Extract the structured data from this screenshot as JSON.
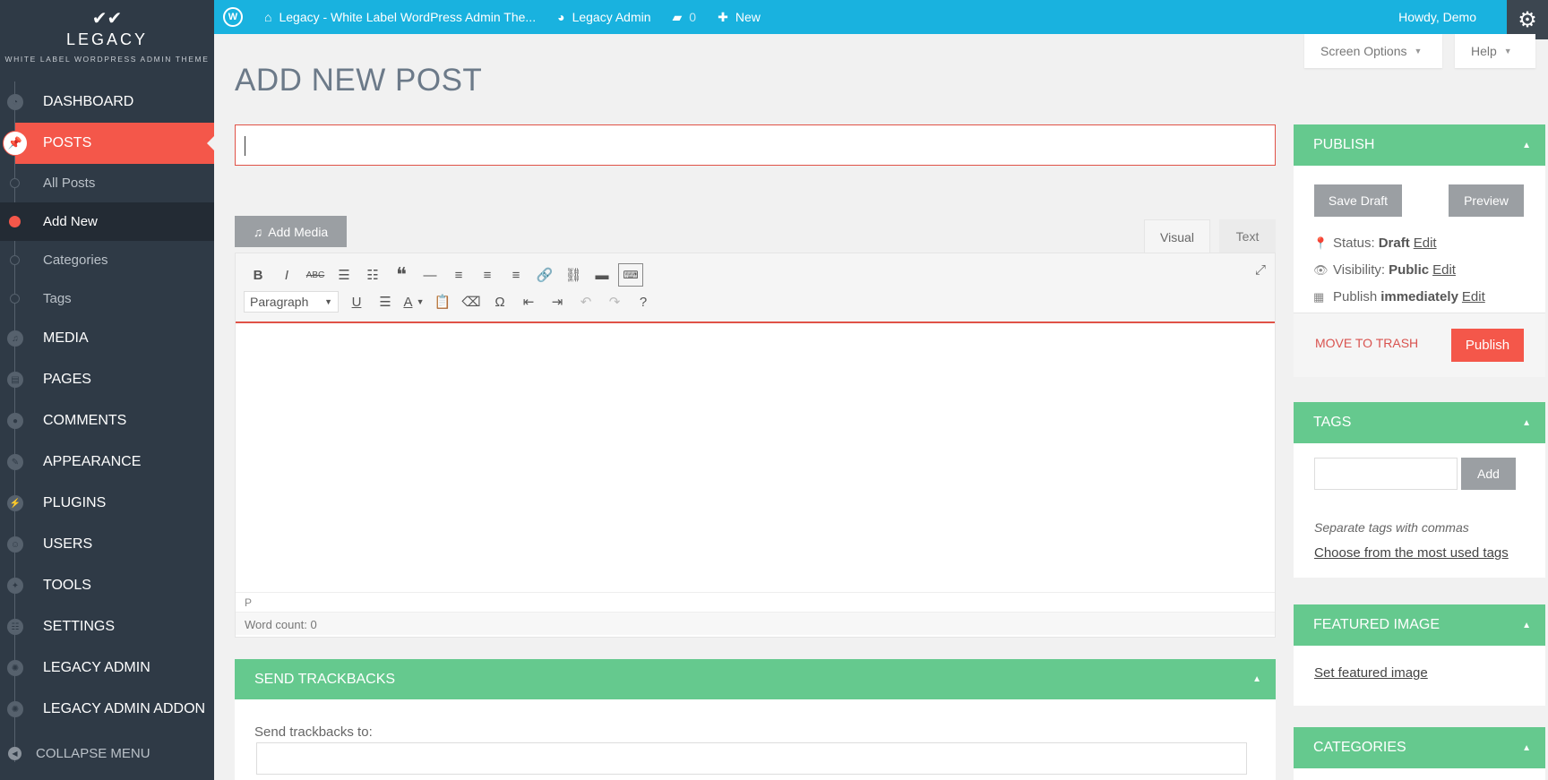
{
  "sidebar": {
    "logo": {
      "name": "LEGACY",
      "tagline": "WHITE LABEL WORDPRESS ADMIN THEME"
    },
    "items": [
      {
        "label": "DASHBOARD",
        "icon": "dashboard-icon"
      },
      {
        "label": "POSTS",
        "icon": "pin-icon"
      },
      {
        "label": "MEDIA",
        "icon": "media-icon"
      },
      {
        "label": "PAGES",
        "icon": "pages-icon"
      },
      {
        "label": "COMMENTS",
        "icon": "comment-icon"
      },
      {
        "label": "APPEARANCE",
        "icon": "brush-icon"
      },
      {
        "label": "PLUGINS",
        "icon": "plug-icon"
      },
      {
        "label": "USERS",
        "icon": "user-icon"
      },
      {
        "label": "TOOLS",
        "icon": "wrench-icon"
      },
      {
        "label": "SETTINGS",
        "icon": "settings-icon"
      },
      {
        "label": "LEGACY ADMIN",
        "icon": "gear-icon"
      },
      {
        "label": "LEGACY ADMIN ADDON",
        "icon": "gear-icon"
      }
    ],
    "posts_sub": [
      "All Posts",
      "Add New",
      "Categories",
      "Tags"
    ],
    "collapse": "COLLAPSE MENU"
  },
  "adminbar": {
    "site": "Legacy - White Label WordPress Admin The...",
    "admin": "Legacy Admin",
    "comments_count": "0",
    "new": "New",
    "howdy": "Howdy, Demo"
  },
  "screen_options": "Screen Options",
  "help": "Help",
  "page_title": "ADD NEW POST",
  "editor": {
    "add_media": "Add Media",
    "tab_visual": "Visual",
    "tab_text": "Text",
    "format": "Paragraph",
    "path": "P",
    "word_count": "Word count: 0"
  },
  "trackbacks": {
    "title": "SEND TRACKBACKS",
    "label": "Send trackbacks to:"
  },
  "publish": {
    "title": "PUBLISH",
    "save_draft": "Save Draft",
    "preview": "Preview",
    "status_label": "Status:",
    "status_value": "Draft",
    "visibility_label": "Visibility:",
    "visibility_value": "Public",
    "publish_label": "Publish",
    "publish_value": "immediately",
    "edit": "Edit",
    "trash": "MOVE TO TRASH",
    "publish_button": "Publish"
  },
  "tags": {
    "title": "TAGS",
    "add": "Add",
    "hint": "Separate tags with commas",
    "link": "Choose from the most used tags"
  },
  "featured": {
    "title": "FEATURED IMAGE",
    "link": "Set featured image"
  },
  "categories": {
    "title": "CATEGORIES"
  },
  "colors": {
    "accent": "#f4574a",
    "green": "#65c98e",
    "topbar": "#19b2df",
    "sidebar": "#2f3a46"
  }
}
